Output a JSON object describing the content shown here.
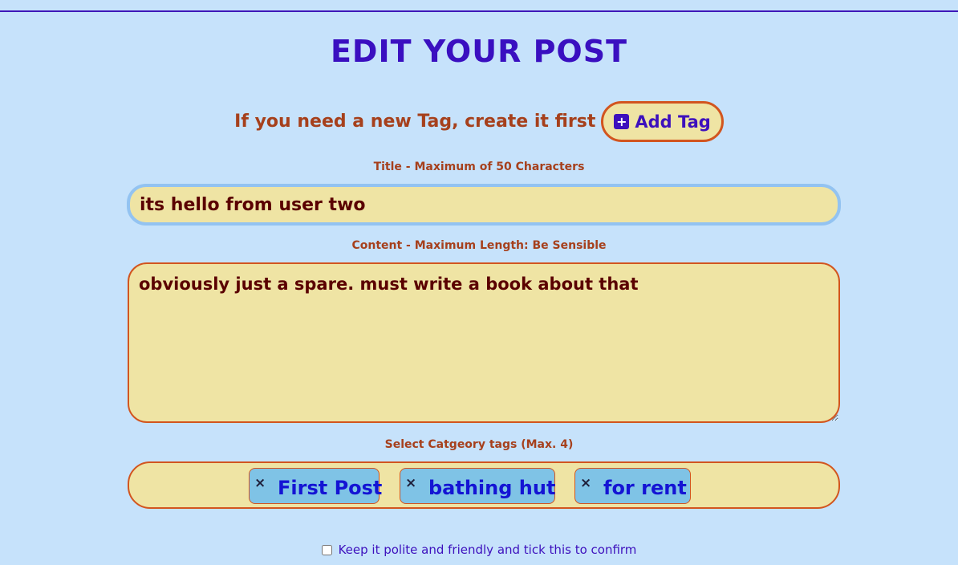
{
  "header": {
    "title": "EDIT YOUR POST"
  },
  "tag_prompt": {
    "text": "If you need a new Tag, create it first",
    "button_icon": "plus-square-icon",
    "button_label": "Add Tag"
  },
  "title_field": {
    "label": "Title - Maximum of 50 Characters",
    "value": "its hello from user two"
  },
  "content_field": {
    "label": "Content - Maximum Length: Be Sensible",
    "value": "obviously just a spare. must write a book about that"
  },
  "tags_field": {
    "label": "Select Catgeory tags (Max. 4)",
    "remove_icon": "×",
    "selected": [
      "First Post",
      "bathing hut",
      "for rent"
    ]
  },
  "confirm": {
    "checked": false,
    "label": "Keep it polite and friendly and tick this to confirm"
  },
  "colors": {
    "background": "#c6e2fb",
    "heading": "#3a0fc0",
    "accent_text": "#a6401c",
    "field_bg": "#efe4a4",
    "field_border": "#d2551f",
    "chip_bg": "#7fc3e6",
    "chip_text": "#1414d4"
  }
}
